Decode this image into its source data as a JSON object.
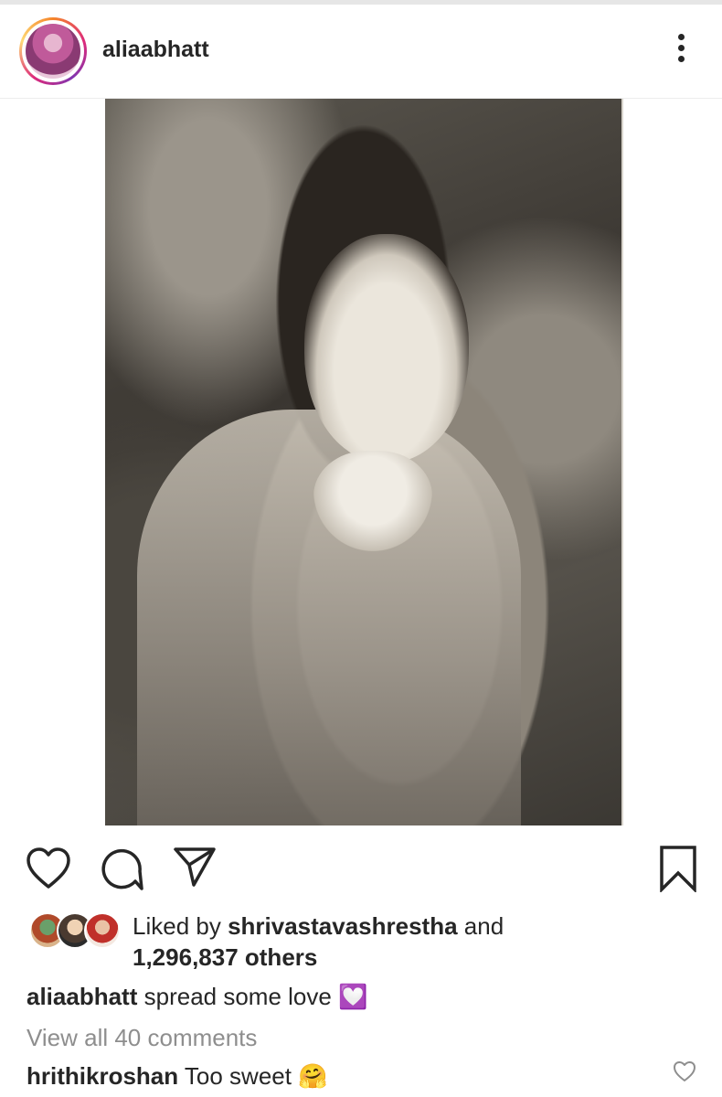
{
  "post": {
    "username": "aliaabhatt",
    "more_icon": "more-vertical-icon"
  },
  "actions": {
    "like_icon": "heart-icon",
    "comment_icon": "comment-icon",
    "share_icon": "send-icon",
    "save_icon": "bookmark-icon"
  },
  "likes": {
    "prefix": "Liked by",
    "liker": "shrivastavashrestha",
    "joiner": "and",
    "others": "1,296,837 others"
  },
  "caption": {
    "username": "aliaabhatt",
    "text": "spread some love 💟"
  },
  "comments": {
    "view_all": "View all 40 comments",
    "items": [
      {
        "username": "hrithikroshan",
        "text": "Too sweet 🤗"
      }
    ]
  }
}
